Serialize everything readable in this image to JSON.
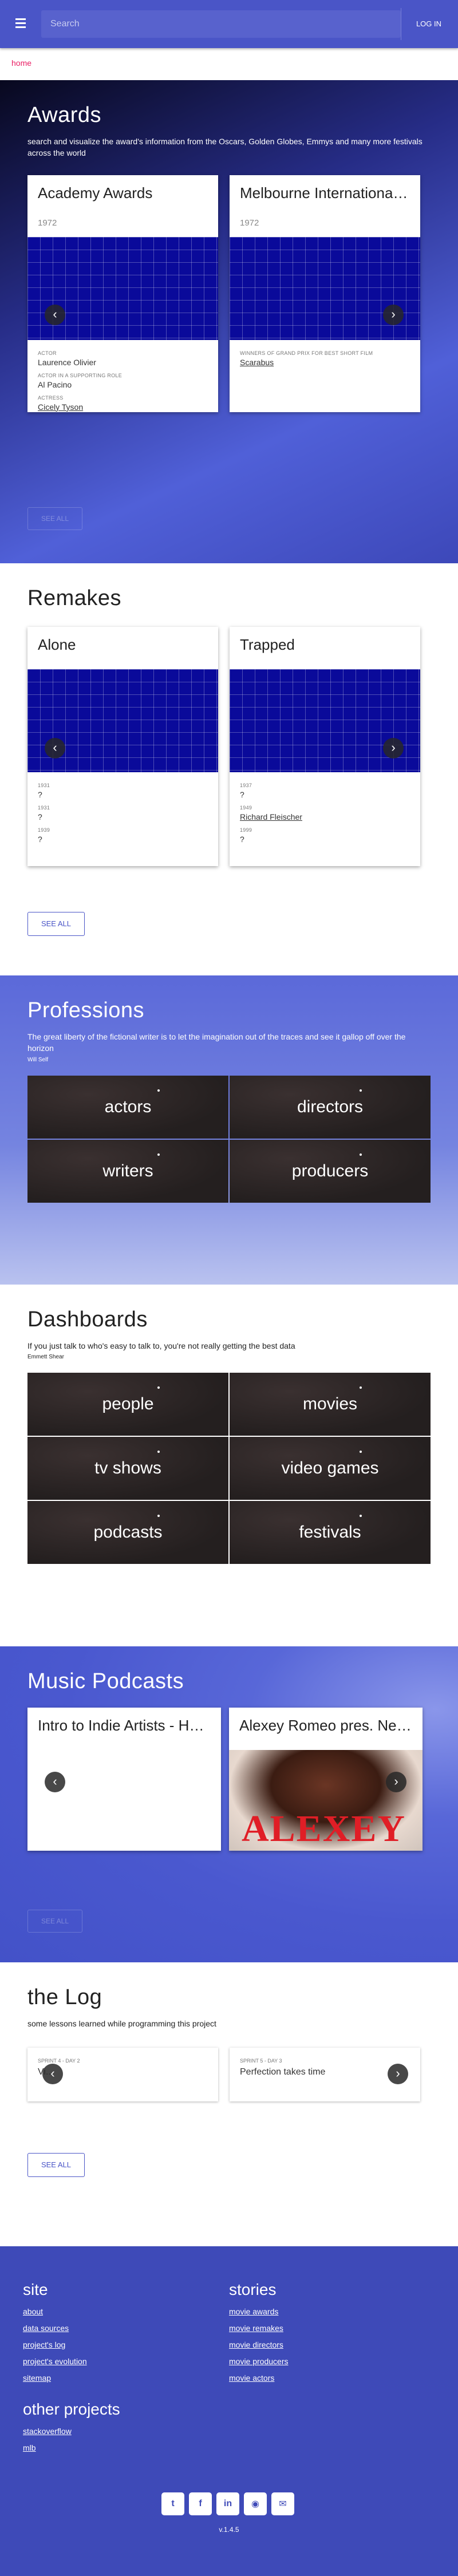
{
  "topbar": {
    "search_placeholder": "Search",
    "login_label": "LOG IN"
  },
  "breadcrumb": {
    "home": "home"
  },
  "awards": {
    "title": "Awards",
    "description": "search and visualize the award's information from the Oscars, Golden Globes, Emmys and many more festivals across the world",
    "cards": [
      {
        "title": "Academy Awards",
        "year": "1972",
        "items": [
          {
            "label": "ACTOR",
            "value": "Laurence Olivier",
            "link": false
          },
          {
            "label": "ACTOR IN A SUPPORTING ROLE",
            "value": "Al Pacino",
            "link": false
          },
          {
            "label": "ACTRESS",
            "value": "Cicely Tyson",
            "link": true
          }
        ]
      },
      {
        "title": "Melbourne International Film Festival",
        "year": "1972",
        "items": [
          {
            "label": "WINNERS OF GRAND PRIX FOR BEST SHORT FILM",
            "value": "Scarabus",
            "link": true
          }
        ]
      }
    ],
    "see_all": "SEE ALL"
  },
  "remakes": {
    "title": "Remakes",
    "cards": [
      {
        "title": "Alone",
        "items": [
          {
            "year": "1931",
            "value": "?",
            "link": false
          },
          {
            "year": "1931",
            "value": "?",
            "link": false
          },
          {
            "year": "1939",
            "value": "?",
            "link": false
          }
        ]
      },
      {
        "title": "Trapped",
        "items": [
          {
            "year": "1937",
            "value": "?",
            "link": false
          },
          {
            "year": "1949",
            "value": "Richard Fleischer",
            "link": true
          },
          {
            "year": "1999",
            "value": "?",
            "link": false
          }
        ]
      }
    ],
    "see_all": "SEE ALL"
  },
  "professions": {
    "title": "Professions",
    "quote": "The great liberty of the fictional writer is to let the imagination out of the traces and see it gallop off over the horizon",
    "author": "Will Self",
    "tiles": [
      "actors",
      "directors",
      "writers",
      "producers"
    ]
  },
  "dashboards": {
    "title": "Dashboards",
    "quote": "If you just talk to who's easy to talk to, you're not really getting the best data",
    "author": "Emmett Shear",
    "tiles": [
      "people",
      "movies",
      "tv shows",
      "video games",
      "podcasts",
      "festivals"
    ]
  },
  "podcasts": {
    "title": "Music Podcasts",
    "cards": [
      {
        "title": "Intro to Indie Artists - Hard Rock"
      },
      {
        "title": "Alexey Romeo pres. New Music",
        "art_text": "ALEXEY"
      }
    ],
    "see_all": "SEE ALL"
  },
  "log": {
    "title": "the Log",
    "description": "some lessons learned while programming this project",
    "cards": [
      {
        "label": "SPRINT 4 - DAY 2",
        "title": "Vi..."
      },
      {
        "label": "SPRINT 5 - DAY 3",
        "title": "Perfection takes time"
      }
    ],
    "see_all": "SEE ALL"
  },
  "footer": {
    "site": {
      "title": "site",
      "links": [
        "about",
        "data sources",
        "project's log",
        "project's evolution",
        "sitemap"
      ]
    },
    "stories": {
      "title": "stories",
      "links": [
        "movie awards",
        "movie remakes",
        "movie directors",
        "movie producers",
        "movie actors"
      ]
    },
    "other": {
      "title": "other projects",
      "links": [
        "stackoverflow",
        "mlb"
      ]
    },
    "socials": [
      {
        "name": "twitter",
        "glyph": "t"
      },
      {
        "name": "facebook",
        "glyph": "f"
      },
      {
        "name": "linkedin",
        "glyph": "in"
      },
      {
        "name": "github",
        "glyph": "◉"
      },
      {
        "name": "email",
        "glyph": "✉"
      }
    ],
    "version": "v.1.4.5"
  },
  "colors": {
    "primary": "#4a55c7",
    "accent": "#e91e63",
    "footer": "#3e4ab8",
    "grid": "#0a0a9a"
  }
}
